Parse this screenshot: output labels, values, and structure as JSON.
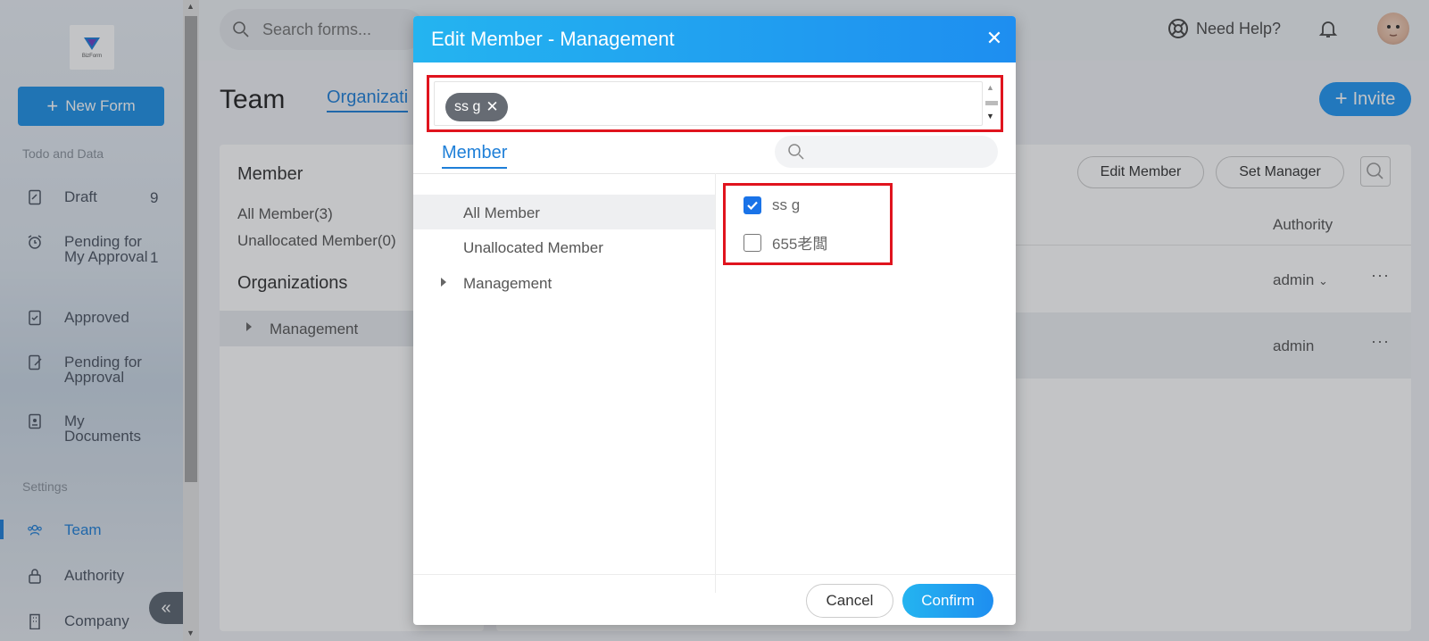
{
  "sidebar": {
    "logo_text": "BizForm",
    "new_form_label": "New Form",
    "section_todo": "Todo and Data",
    "items": [
      {
        "label": "Draft",
        "count": "9"
      },
      {
        "label": "Pending for My Approval",
        "count": "1"
      },
      {
        "label": "Approved",
        "count": ""
      },
      {
        "label": "Pending for Approval",
        "count": ""
      },
      {
        "label": "My Documents",
        "count": ""
      }
    ],
    "section_settings": "Settings",
    "settings_items": [
      {
        "label": "Team"
      },
      {
        "label": "Authority"
      },
      {
        "label": "Company"
      }
    ],
    "collapse_icon": "«"
  },
  "topbar": {
    "search_placeholder": "Search forms...",
    "help_label": "Need Help?"
  },
  "main": {
    "title": "Team",
    "tab_label": "Organizati",
    "invite_label": "Invite",
    "left_panel": {
      "member_heading": "Member",
      "all_member": "All Member(3)",
      "unallocated_member": "Unallocated Member(0)",
      "organizations_heading": "Organizations",
      "org_item": "Management"
    },
    "right_panel": {
      "edit_member_label": "Edit Member",
      "set_manager_label": "Set Manager",
      "authority_header": "Authority",
      "rows": [
        {
          "authority": "admin"
        },
        {
          "authority": "admin"
        }
      ]
    }
  },
  "modal": {
    "title": "Edit Member - Management",
    "selected_chips": [
      "ss g"
    ],
    "tab_label": "Member",
    "tree": [
      {
        "label": "All Member"
      },
      {
        "label": "Unallocated Member"
      },
      {
        "label": "Management"
      }
    ],
    "members": [
      {
        "name": "ss g",
        "checked": true
      },
      {
        "name": "655老闆",
        "checked": false
      }
    ],
    "cancel_label": "Cancel",
    "confirm_label": "Confirm"
  },
  "colors": {
    "accent": "#1e7fd8",
    "highlight": "#e0141e",
    "modal_header": "#1e8ef0"
  }
}
